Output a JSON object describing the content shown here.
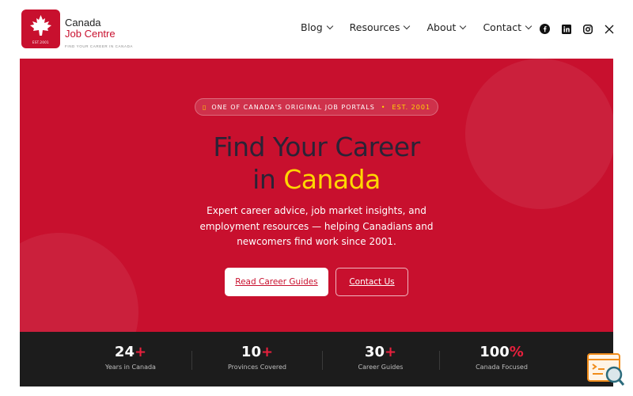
{
  "brand": {
    "line1": "Canada",
    "line2": "Job Centre",
    "tagline": "FIND YOUR CAREER IN CANADA",
    "mark_tag": "EST.2001",
    "color": "#c8102e"
  },
  "nav": {
    "items": [
      {
        "label": "Blog"
      },
      {
        "label": "Resources"
      },
      {
        "label": "About"
      },
      {
        "label": "Contact"
      }
    ],
    "socials": [
      "facebook-icon",
      "linkedin-icon",
      "instagram-icon",
      "x-icon"
    ]
  },
  "hero": {
    "pill_text": "ONE OF CANADA'S ORIGINAL JOB PORTALS",
    "pill_est": "EST. 2001",
    "title_line1": "Find Your Career",
    "title_line2_prefix": "in ",
    "title_line2_highlight": "Canada",
    "subtitle": "Expert career advice, job market insights, and employment resources — helping Canadians and newcomers find work since 2001.",
    "primary_cta": "Read Career Guides",
    "secondary_cta": "Contact Us",
    "bg_color": "#c8102e",
    "highlight_color": "#ffd700"
  },
  "stats": [
    {
      "value": "24",
      "suffix": "+",
      "label": "Years in Canada"
    },
    {
      "value": "10",
      "suffix": "+",
      "label": "Provinces Covered"
    },
    {
      "value": "30",
      "suffix": "+",
      "label": "Career Guides"
    },
    {
      "value": "100",
      "suffix": "%",
      "label": "Canada Focused"
    }
  ]
}
